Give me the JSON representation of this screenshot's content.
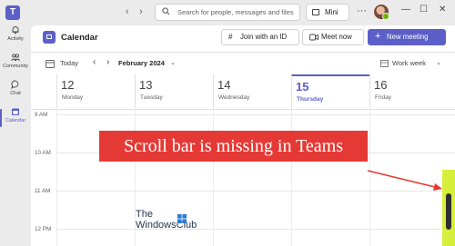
{
  "topbar": {
    "search_placeholder": "Search for people, messages and files",
    "mini_label": "Mini",
    "more": "···",
    "minimize": "—",
    "maximize": "☐",
    "close": "✕"
  },
  "rail": [
    {
      "label": "Activity",
      "icon": "bell-icon"
    },
    {
      "label": "Community",
      "icon": "community-icon"
    },
    {
      "label": "Chat",
      "icon": "chat-icon"
    },
    {
      "label": "Calendar",
      "icon": "calendar-icon",
      "active": true
    }
  ],
  "header": {
    "title": "Calendar",
    "join_id": "Join with an ID",
    "meet_now": "Meet now",
    "new_meeting": "New meeting"
  },
  "toolbar": {
    "today": "Today",
    "month": "February 2024",
    "view": "Work week"
  },
  "days": [
    {
      "num": "12",
      "name": "Monday"
    },
    {
      "num": "13",
      "name": "Tuesday"
    },
    {
      "num": "14",
      "name": "Wednesday"
    },
    {
      "num": "15",
      "name": "Thursday",
      "today": true
    },
    {
      "num": "16",
      "name": "Friday"
    }
  ],
  "times": [
    "9 AM",
    "10 AM",
    "11 AM",
    "12 PM"
  ],
  "overlay": {
    "banner": "Scroll bar is missing in Teams",
    "watermark_line1": "The",
    "watermark_line2": "WindowsClub"
  },
  "colors": {
    "accent": "#5b5fc7",
    "banner": "#e53935",
    "scroll_highlight": "#d6ef3a"
  }
}
